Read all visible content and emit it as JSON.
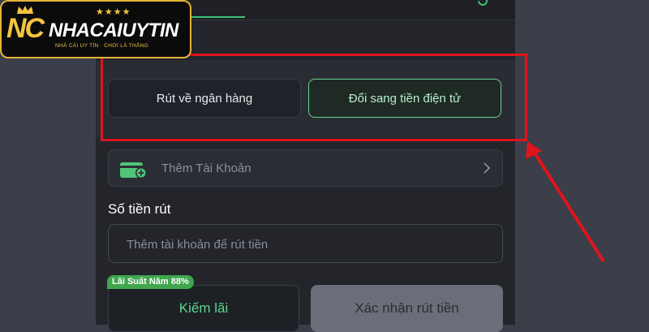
{
  "logo": {
    "initials": "NC",
    "brand": "NHACAIUYTIN",
    "stars": "★★★★",
    "tagline": "NHÀ CÁI UY TÍN · CHƠI LÀ THẮNG"
  },
  "withdraw_methods": {
    "bank_label": "Rút về ngân hàng",
    "crypto_label": "Đổi sang tiền điện tử",
    "selected": "crypto"
  },
  "account": {
    "add_label": "Thêm Tài Khoản",
    "icon": "wallet-add-icon"
  },
  "amount": {
    "label": "Số tiền rút",
    "placeholder": "Thêm tài khoản để rút tiền"
  },
  "actions": {
    "interest_badge": "Lãi Suất Năm 88%",
    "interest_label": "Kiếm lãi",
    "confirm_label": "Xác nhận rút tiền"
  },
  "colors": {
    "accent_green": "#5fd68a",
    "highlight_red": "#e0141c",
    "logo_gold": "#f5c440"
  }
}
